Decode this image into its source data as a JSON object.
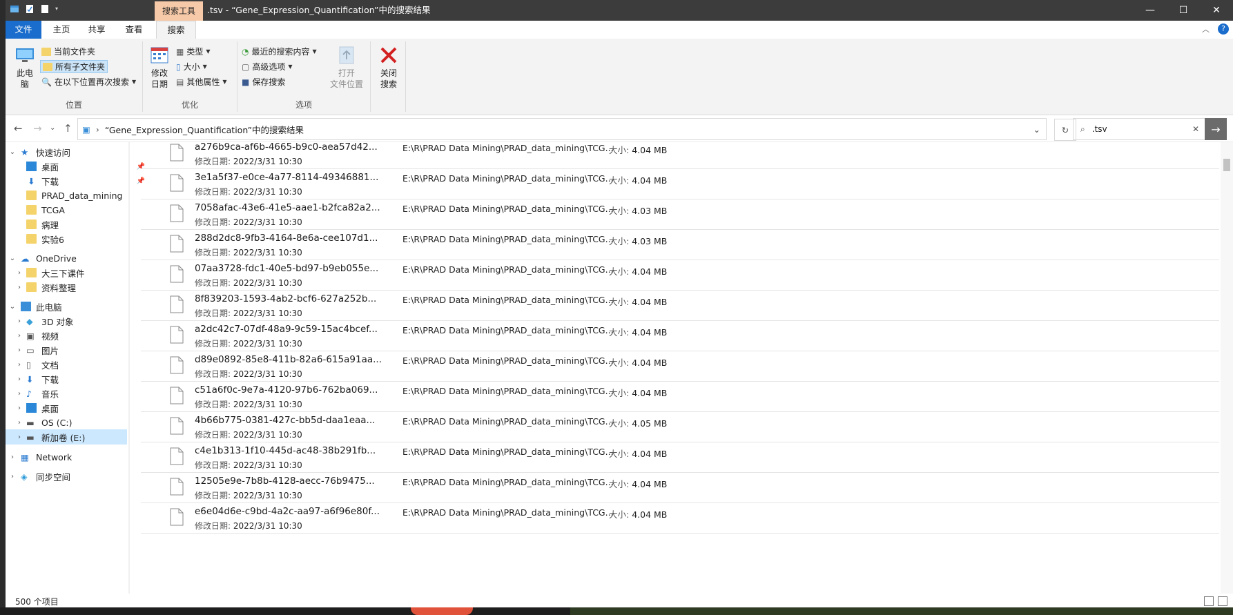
{
  "window": {
    "title": ".tsv - “Gene_Expression_Quantification”中的搜索结果",
    "context_tab": "搜索工具"
  },
  "ribbon_tabs": [
    "文件",
    "主页",
    "共享",
    "查看",
    "搜索"
  ],
  "ribbon": {
    "location": {
      "label": "位置",
      "this_pc": "此电\n脑",
      "current_folder": "当前文件夹",
      "all_subfolders": "所有子文件夹",
      "search_again_in": "在以下位置再次搜索"
    },
    "refine": {
      "label": "优化",
      "date_modified": "修改\n日期",
      "kind": "类型",
      "size": "大小",
      "other_props": "其他属性"
    },
    "options": {
      "label": "选项",
      "recent_searches": "最近的搜索内容",
      "advanced": "高级选项",
      "save_search": "保存搜索",
      "open_location": "打开\n文件位置"
    },
    "close": {
      "label": "关闭\n搜索"
    }
  },
  "address": {
    "path": "“Gene_Expression_Quantification”中的搜索结果",
    "search_value": ".tsv"
  },
  "nav": {
    "quick_access": "快速访问",
    "quick_items": [
      "桌面",
      "下载",
      "PRAD_data_mining",
      "TCGA",
      "病理",
      "实验6"
    ],
    "onedrive": "OneDrive",
    "onedrive_items": [
      "大三下课件",
      "资料整理"
    ],
    "this_pc": "此电脑",
    "pc_items": [
      "3D 对象",
      "视频",
      "图片",
      "文档",
      "下载",
      "音乐",
      "桌面",
      "OS (C:)",
      "新加卷 (E:)"
    ],
    "network": "Network",
    "sync": "同步空间"
  },
  "files": [
    {
      "name": "a276b9ca-af6b-4665-b9c0-aea57d42...",
      "date": "2022/3/31 10:30",
      "path": "E:\\R\\PRAD Data Mining\\PRAD_data_mining\\TCG...",
      "size": "4.04 MB"
    },
    {
      "name": "3e1a5f37-e0ce-4a77-8114-49346881...",
      "date": "2022/3/31 10:30",
      "path": "E:\\R\\PRAD Data Mining\\PRAD_data_mining\\TCG...",
      "size": "4.04 MB"
    },
    {
      "name": "7058afac-43e6-41e5-aae1-b2fca82a2...",
      "date": "2022/3/31 10:30",
      "path": "E:\\R\\PRAD Data Mining\\PRAD_data_mining\\TCG...",
      "size": "4.03 MB"
    },
    {
      "name": "288d2dc8-9fb3-4164-8e6a-cee107d1...",
      "date": "2022/3/31 10:30",
      "path": "E:\\R\\PRAD Data Mining\\PRAD_data_mining\\TCG...",
      "size": "4.03 MB"
    },
    {
      "name": "07aa3728-fdc1-40e5-bd97-b9eb055e...",
      "date": "2022/3/31 10:30",
      "path": "E:\\R\\PRAD Data Mining\\PRAD_data_mining\\TCG...",
      "size": "4.04 MB"
    },
    {
      "name": "8f839203-1593-4ab2-bcf6-627a252b...",
      "date": "2022/3/31 10:30",
      "path": "E:\\R\\PRAD Data Mining\\PRAD_data_mining\\TCG...",
      "size": "4.04 MB"
    },
    {
      "name": "a2dc42c7-07df-48a9-9c59-15ac4bcef...",
      "date": "2022/3/31 10:30",
      "path": "E:\\R\\PRAD Data Mining\\PRAD_data_mining\\TCG...",
      "size": "4.04 MB"
    },
    {
      "name": "d89e0892-85e8-411b-82a6-615a91aa...",
      "date": "2022/3/31 10:30",
      "path": "E:\\R\\PRAD Data Mining\\PRAD_data_mining\\TCG...",
      "size": "4.04 MB"
    },
    {
      "name": "c51a6f0c-9e7a-4120-97b6-762ba069...",
      "date": "2022/3/31 10:30",
      "path": "E:\\R\\PRAD Data Mining\\PRAD_data_mining\\TCG...",
      "size": "4.04 MB"
    },
    {
      "name": "4b66b775-0381-427c-bb5d-daa1eaa...",
      "date": "2022/3/31 10:30",
      "path": "E:\\R\\PRAD Data Mining\\PRAD_data_mining\\TCG...",
      "size": "4.05 MB"
    },
    {
      "name": "c4e1b313-1f10-445d-ac48-38b291fb...",
      "date": "2022/3/31 10:30",
      "path": "E:\\R\\PRAD Data Mining\\PRAD_data_mining\\TCG...",
      "size": "4.04 MB"
    },
    {
      "name": "12505e9e-7b8b-4128-aecc-76b9475...",
      "date": "2022/3/31 10:30",
      "path": "E:\\R\\PRAD Data Mining\\PRAD_data_mining\\TCG...",
      "size": "4.04 MB"
    },
    {
      "name": "e6e04d6e-c9bd-4a2c-aa97-a6f96e80f...",
      "date": "2022/3/31 10:30",
      "path": "E:\\R\\PRAD Data Mining\\PRAD_data_mining\\TCG...",
      "size": "4.04 MB"
    }
  ],
  "labels": {
    "date_prefix": "修改日期:",
    "size_prefix": "大小:"
  },
  "status": {
    "count": "500 个项目"
  },
  "colors": {
    "accent": "#1a6dcc",
    "titlebar": "#3c3c3c",
    "selection": "#cce8ff",
    "context_tab": "#f6c9a8"
  }
}
